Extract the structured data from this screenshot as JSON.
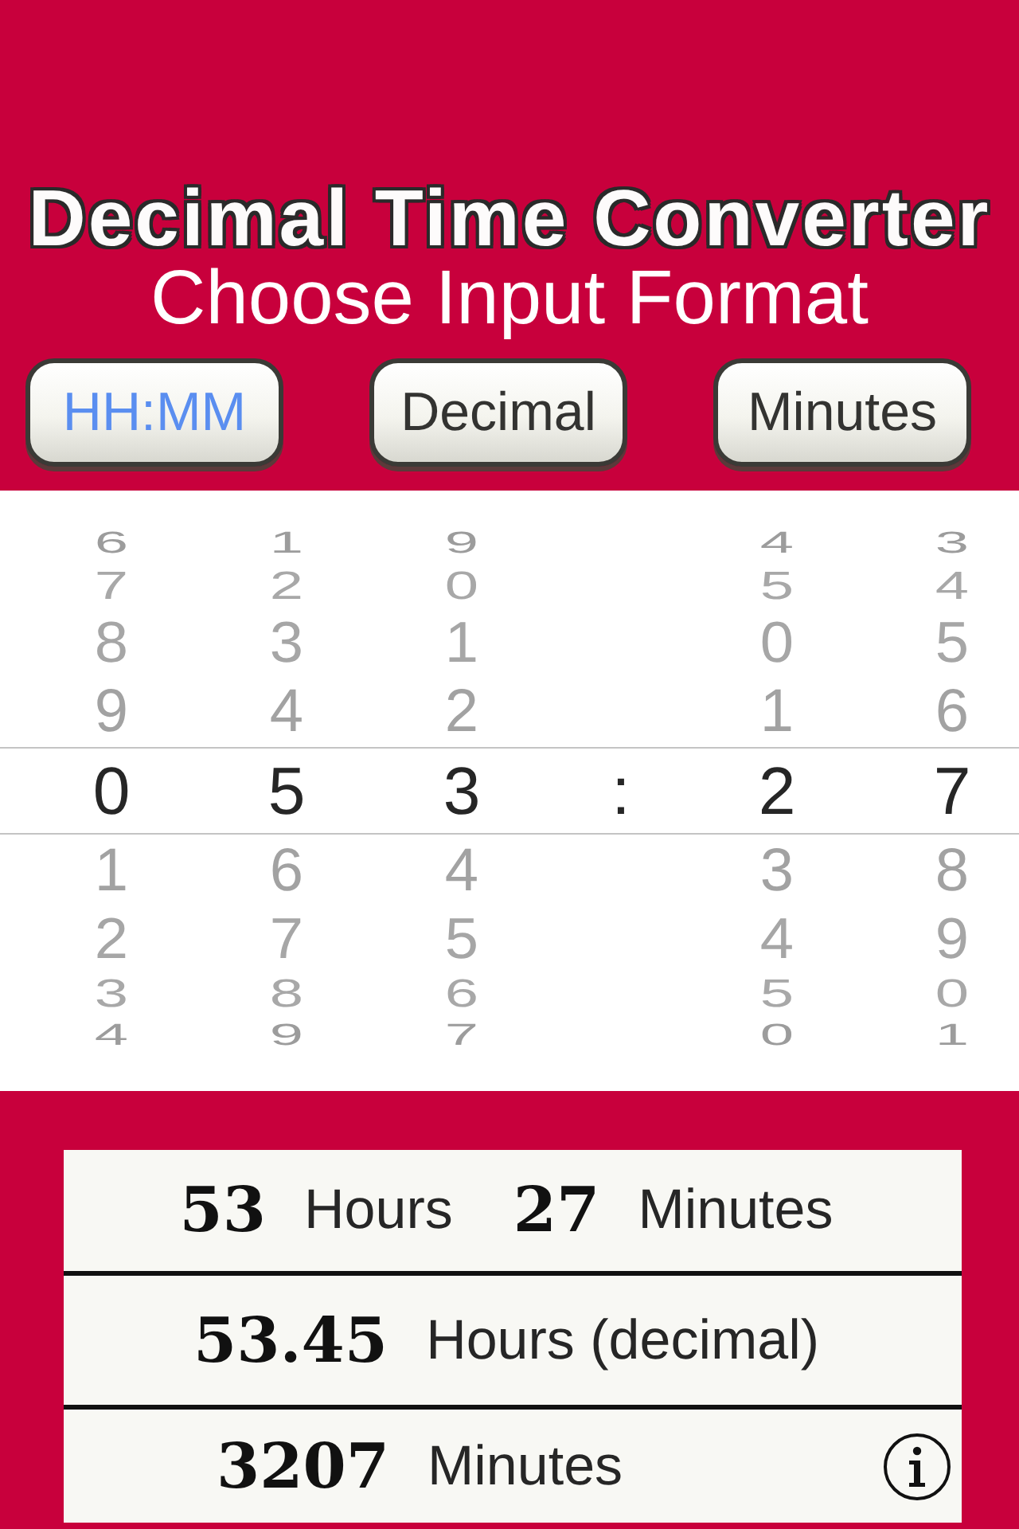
{
  "title": "Decimal Time Converter",
  "subtitle": "Choose Input Format",
  "format_buttons": [
    {
      "label": "HH:MM",
      "selected": true
    },
    {
      "label": "Decimal",
      "selected": false
    },
    {
      "label": "Minutes",
      "selected": false
    }
  ],
  "picker": {
    "columns": [
      {
        "kind": "wheel",
        "above": [
          "6",
          "7",
          "8",
          "9"
        ],
        "value": "0",
        "below": [
          "1",
          "2",
          "3",
          "4"
        ]
      },
      {
        "kind": "wheel",
        "above": [
          "1",
          "2",
          "3",
          "4"
        ],
        "value": "5",
        "below": [
          "6",
          "7",
          "8",
          "9"
        ]
      },
      {
        "kind": "wheel",
        "above": [
          "9",
          "0",
          "1",
          "2"
        ],
        "value": "3",
        "below": [
          "4",
          "5",
          "6",
          "7"
        ]
      },
      {
        "kind": "separator",
        "label": ":"
      },
      {
        "kind": "wheel",
        "above": [
          "4",
          "5",
          "0",
          "1"
        ],
        "value": "2",
        "below": [
          "3",
          "4",
          "5",
          "0"
        ]
      },
      {
        "kind": "wheel",
        "above": [
          "3",
          "4",
          "5",
          "6"
        ],
        "value": "7",
        "below": [
          "8",
          "9",
          "0",
          "1"
        ]
      }
    ]
  },
  "results": [
    {
      "parts": [
        {
          "value": "53",
          "unit": "Hours"
        },
        {
          "value": "27",
          "unit": "Minutes"
        }
      ]
    },
    {
      "parts": [
        {
          "value": "53.45",
          "unit": "Hours (decimal)"
        }
      ]
    },
    {
      "parts": [
        {
          "value": "3207",
          "unit": "Minutes"
        }
      ]
    }
  ]
}
